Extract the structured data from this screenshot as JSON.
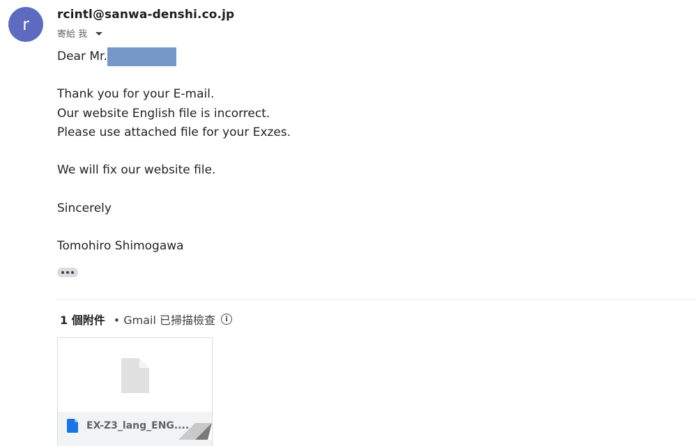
{
  "message": {
    "avatar_letter": "r",
    "avatar_color": "#5c6bc0",
    "sender_email": "rcintl@sanwa-denshi.co.jp",
    "recipient_label": "寄給 我",
    "recipient_dropdown_icon": "caret-down-icon",
    "body_lines": [
      "Dear Mr.",
      "",
      "Thank you for your E-mail.",
      "Our website English file is incorrect.",
      "Please use attached file for your Exzes.",
      "",
      "We will fix our website file.",
      "",
      "Sincerely",
      "",
      "Tomohiro Shimogawa"
    ],
    "redaction_color": "#7698c9",
    "show_trimmed_icon": "more-horizontal-icon"
  },
  "attachments": {
    "count_label": "1 個附件",
    "scan_label": "• Gmail 已掃描檢查",
    "info_icon": "info-icon",
    "items": [
      {
        "file_name": "EX-Z3_lang_ENG....",
        "file_icon": "doc-file-icon",
        "preview_icon": "blank-document-icon"
      }
    ]
  }
}
